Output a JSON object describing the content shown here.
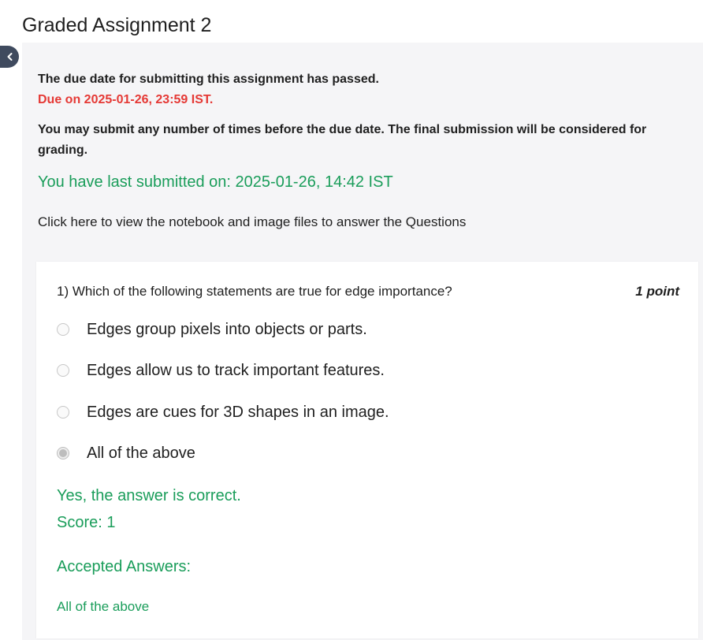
{
  "page": {
    "title": "Graded Assignment 2"
  },
  "notice": {
    "title": "The due date for submitting this assignment has passed.",
    "due": "Due on 2025-01-26, 23:59 IST.",
    "submit_note": "You may submit any number of times before the due date. The final submission will be considered for grading.",
    "last_submitted": "You have last submitted on: 2025-01-26, 14:42 IST",
    "view_link": "Click here to view the notebook and image files to answer the Questions"
  },
  "question": {
    "text": "1) Which of the following statements are true for edge importance?",
    "points": "1 point",
    "options": [
      {
        "label": "Edges group pixels into objects or parts.",
        "selected": false
      },
      {
        "label": "Edges allow us to track important features.",
        "selected": false
      },
      {
        "label": "Edges are cues for 3D shapes in an image.",
        "selected": false
      },
      {
        "label": "All of the above",
        "selected": true
      }
    ],
    "feedback": "Yes, the answer is correct.",
    "score": "Score: 1",
    "accepted_label": "Accepted Answers:",
    "accepted_value": "All of the above"
  },
  "colors": {
    "due_red": "#e53935",
    "success_green": "#1a9d5a",
    "panel_bg": "#f5f5f7",
    "collapse_button": "#3f4a5e"
  },
  "icons": {
    "collapse": "chevron-left-icon"
  }
}
